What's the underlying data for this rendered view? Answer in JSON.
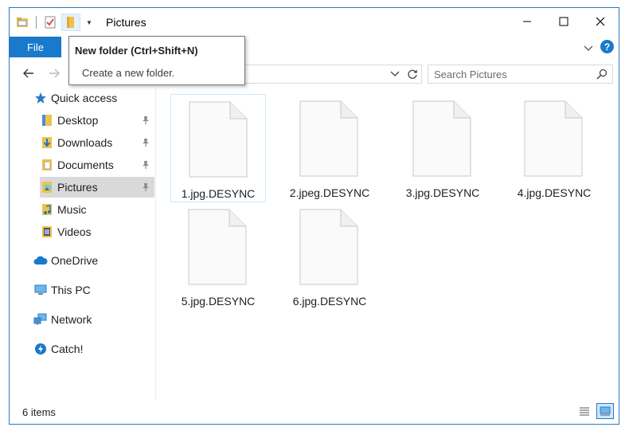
{
  "window": {
    "title": "Pictures",
    "controls": {
      "minimize": "—",
      "maximize": "☐",
      "close": "✕"
    }
  },
  "ribbon": {
    "file_tab": "File",
    "help": "?"
  },
  "address": {
    "path": "",
    "search_placeholder": "Search Pictures"
  },
  "tooltip": {
    "title": "New folder (Ctrl+Shift+N)",
    "description": "Create a new folder."
  },
  "nav": {
    "quick_access": "Quick access",
    "items": [
      {
        "label": "Desktop",
        "icon": "desktop-icon",
        "pinned": true
      },
      {
        "label": "Downloads",
        "icon": "downloads-icon",
        "pinned": true
      },
      {
        "label": "Documents",
        "icon": "documents-icon",
        "pinned": true
      },
      {
        "label": "Pictures",
        "icon": "pictures-icon",
        "pinned": true,
        "selected": true
      },
      {
        "label": "Music",
        "icon": "music-icon",
        "pinned": false
      },
      {
        "label": "Videos",
        "icon": "videos-icon",
        "pinned": false
      }
    ],
    "onedrive": "OneDrive",
    "this_pc": "This PC",
    "network": "Network",
    "catch": "Catch!"
  },
  "files": [
    {
      "name": "1.jpg.DESYNC",
      "selected": true
    },
    {
      "name": "2.jpeg.DESYNC"
    },
    {
      "name": "3.jpg.DESYNC"
    },
    {
      "name": "4.jpg.DESYNC"
    },
    {
      "name": "5.jpg.DESYNC"
    },
    {
      "name": "6.jpg.DESYNC"
    }
  ],
  "status": {
    "item_count": "6 items"
  },
  "colors": {
    "accent": "#1979ca",
    "selection": "#d9d9d9",
    "folder": "#f0c24b"
  }
}
